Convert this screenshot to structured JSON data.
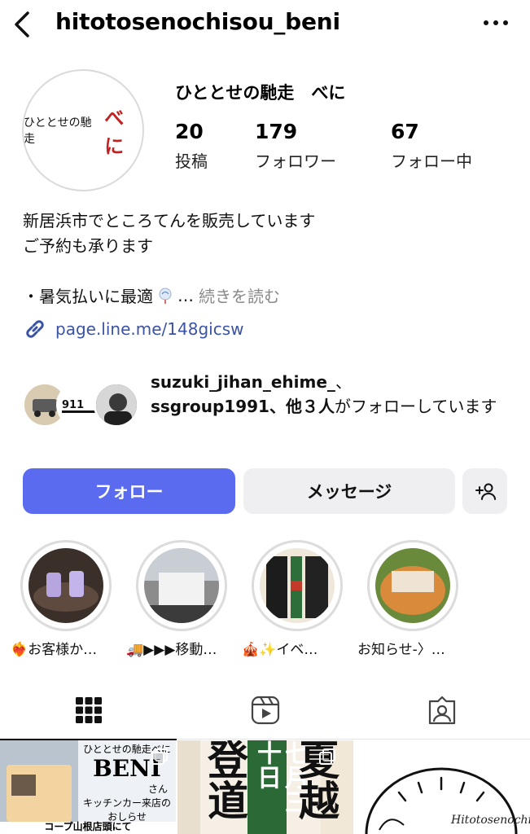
{
  "header": {
    "username": "hitotosenochisou_beni"
  },
  "profile": {
    "avatar_text_small": "ひととせの馳走",
    "avatar_text_big": "べに",
    "display_name": "ひととせの馳走　べに",
    "stats": [
      {
        "value": "20",
        "label": "投稿"
      },
      {
        "value": "179",
        "label": "フォロワー"
      },
      {
        "value": "67",
        "label": "フォロー中"
      }
    ],
    "bio_lines": [
      "新居浜市でところてんを販売しています",
      "ご予約も承ります"
    ],
    "bio_more_prefix": "・暑気払いに最適",
    "bio_ellipsis": "…",
    "read_more": "続きを読む",
    "link": "page.line.me/148gicsw"
  },
  "followed_by": {
    "names": "suzuki_jihan_ehime_",
    "sep": "、",
    "names2": "ssgroup1991",
    "others": "、他３人",
    "suffix": "がフォローしています"
  },
  "buttons": {
    "follow": "フォロー",
    "message": "メッセージ"
  },
  "highlights": [
    {
      "label": "❤️‍🔥お客様か…"
    },
    {
      "label": "🚚▶▶▶移動…"
    },
    {
      "label": "🎪✨イベ…"
    },
    {
      "label": "お知らせ-〉…"
    }
  ],
  "posts": [
    {
      "title": "ひととせの馳走べに",
      "big": "BENI",
      "sub": "さん",
      "line1": "キッチンカー来店の",
      "line2": "おしらせ",
      "footer": "コープ山根店頭にて"
    },
    {
      "big1": "登道",
      "big2": "夏越",
      "red": "七月三十日"
    },
    {
      "script": "Hitotosenochi"
    }
  ]
}
